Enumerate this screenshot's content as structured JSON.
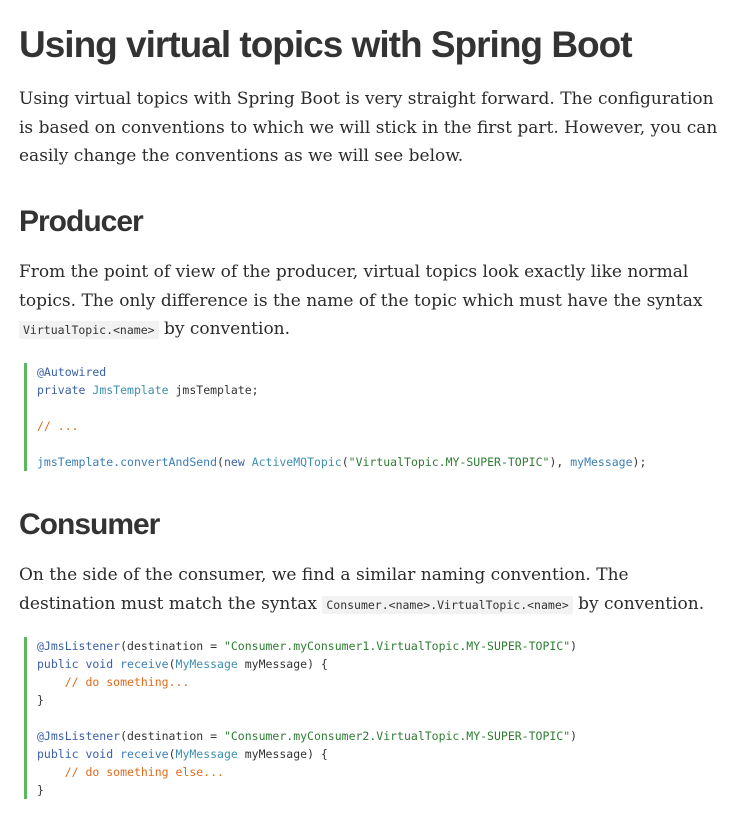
{
  "title": "Using virtual topics with Spring Boot",
  "intro": "Using virtual topics with Spring Boot is very straight forward. The configuration is based on conventions to which we will stick in the first part. However, you can easily change the conventions as we will see below.",
  "producer": {
    "heading": "Producer",
    "text_before": "From the point of view of the producer, virtual topics look exactly like normal topics. The only difference is the name of the topic which must have the syntax ",
    "inline_code": "VirtualTopic.<name>",
    "text_after": " by convention.",
    "code": {
      "l1_ann": "@Autowired",
      "l2_kw": "private",
      "l2_type": "JmsTemplate",
      "l2_rest": " jmsTemplate;",
      "l4_cm": "// ...",
      "l6_obj": "jmsTemplate.",
      "l6_fn": "convertAndSend",
      "l6_p1": "(",
      "l6_new": "new",
      "l6_cls": "ActiveMQTopic",
      "l6_p2": "(",
      "l6_str": "\"VirtualTopic.MY-SUPER-TOPIC\"",
      "l6_p3": "), ",
      "l6_arg": "myMessage",
      "l6_end": ");"
    }
  },
  "consumer": {
    "heading": "Consumer",
    "text_before": "On the side of the consumer, we find a similar naming convention. The destination must match the syntax ",
    "inline_code": "Consumer.<name>.VirtualTopic.<name>",
    "text_after": " by convention.",
    "code": {
      "a1": "@JmsListener",
      "a1_p": "(destination = ",
      "a1_str": "\"Consumer.myConsumer1.VirtualTopic.MY-SUPER-TOPIC\"",
      "a1_end": ")",
      "m1_kw": "public void",
      "m1_fn": "receive",
      "m1_p": "(",
      "m1_type": "MyMessage",
      "m1_arg": " myMessage) {",
      "c1": "// do something...",
      "close1": "}",
      "a2": "@JmsListener",
      "a2_p": "(destination = ",
      "a2_str": "\"Consumer.myConsumer2.VirtualTopic.MY-SUPER-TOPIC\"",
      "a2_end": ")",
      "m2_kw": "public void",
      "m2_fn": "receive",
      "m2_p": "(",
      "m2_type": "MyMessage",
      "m2_arg": " myMessage) {",
      "c2": "// do something else...",
      "close2": "}"
    }
  },
  "colors": {
    "code_border": "#5cb85c",
    "comment": "#e06a1b",
    "string": "#2e7d32",
    "keyword": "#3a5fa6"
  }
}
